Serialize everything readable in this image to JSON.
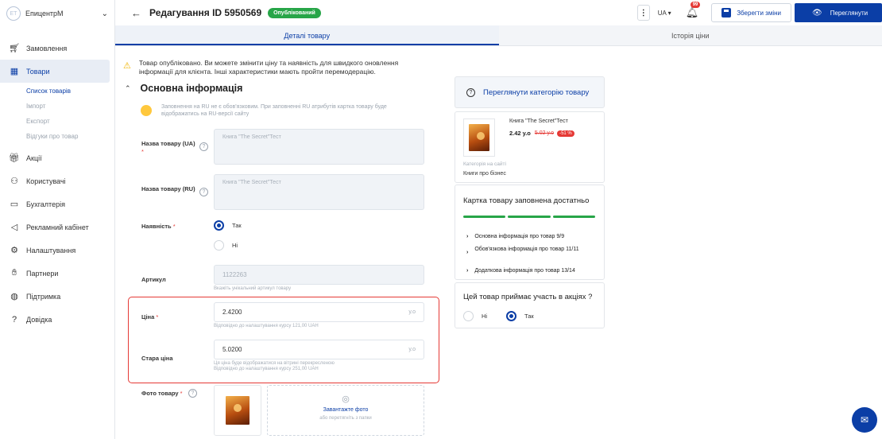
{
  "sidebar": {
    "brand_logo": "ЕТ",
    "brand_name": "ЕпицентрМ",
    "items": [
      {
        "label": "Замовлення",
        "icon": "cart-icon"
      },
      {
        "label": "Товари",
        "icon": "grid-icon"
      },
      {
        "label": "Акції",
        "icon": "gift-icon"
      },
      {
        "label": "Користувачі",
        "icon": "users-icon"
      },
      {
        "label": "Бухгалтерія",
        "icon": "briefcase-icon"
      },
      {
        "label": "Рекламний кабінет",
        "icon": "megaphone-icon"
      },
      {
        "label": "Налаштування",
        "icon": "gear-icon"
      },
      {
        "label": "Партнери",
        "icon": "handshake-icon"
      },
      {
        "label": "Підтримка",
        "icon": "chat-icon"
      },
      {
        "label": "Довідка",
        "icon": "help-icon"
      }
    ],
    "subitems": [
      "Список товарів",
      "Імпорт",
      "Експорт",
      "Відгуки про товар"
    ]
  },
  "header": {
    "title": "Редагування ID 5950569",
    "status": "Опублікований",
    "lang": "UA",
    "notifications": "99",
    "save_label": "Зберегти зміни",
    "view_label": "Переглянути"
  },
  "tabs": [
    "Деталі товару",
    "Історія ціни"
  ],
  "main": {
    "alert": "Товар опубліковано. Ви можете змінити ціну та наявність для швидкого оновлення інформації для клієнта. Інші характеристики мають пройти перемодерацію.",
    "section_title": "Основна інформація",
    "ru_note": "Заповнення на RU не є обов'язковим. При заповненні RU атрибутів картка товару буде відображатись на RU-версії сайту",
    "name_ua_label": "Назва товару (UA)",
    "name_ua_value": "Книга \"The Secret\"Тест",
    "name_ru_label": "Назва товару (RU)",
    "name_ru_value": "Книга \"The Secret\"Тест",
    "availability_label": "Наявність",
    "availability_yes": "Так",
    "availability_no": "Ні",
    "sku_label": "Артикул",
    "sku_value": "1122263",
    "sku_hint": "Вкажіть унікальний артикул товару",
    "price_label": "Ціна",
    "price_value": "2.4200",
    "price_unit": "у.о",
    "price_hint": "Відповідно до налаштування курсу 121,00 UAH",
    "old_price_label": "Стара ціна",
    "old_price_value": "5.0200",
    "old_price_unit": "у.о",
    "old_price_hint1": "Ця ціна буде відображатися на вітрині перекресленою",
    "old_price_hint2": "Відповідно до налаштування курсу 251,00 UAH",
    "photo_label": "Фото товару",
    "upload_label": "Завантажте фото",
    "upload_hint": "або перетягніть з папки"
  },
  "right": {
    "category_button": "Переглянути категорію товару",
    "product_name": "Книга \"The Secret\"Тест",
    "price": "2.42 у.о",
    "old_price": "5.02 у.о",
    "discount": "-51 %",
    "category_label": "Категорія на сайті",
    "category_value": "Книги про бізнес",
    "fill_title": "Картка товару заповнена достатньо",
    "fill_progress": 1.0,
    "fill_rows": [
      "Основна інформація про товар 9/9",
      "Обов'язкова інформація про товар 11/11",
      "Додаткова інформація про товар 13/14"
    ],
    "promo_title": "Цей товар приймає участь в акціях ?",
    "promo_no": "Ні",
    "promo_yes": "Так"
  },
  "colors": {
    "accent": "#0b3ea6",
    "success": "#27a548",
    "danger": "#e53935",
    "warning": "#f0b400"
  }
}
